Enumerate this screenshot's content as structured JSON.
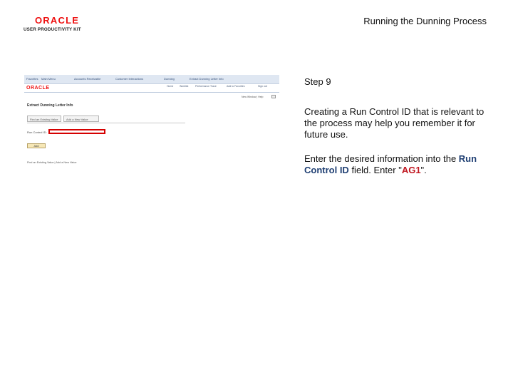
{
  "logo": {
    "brand": "ORACLE",
    "subtitle": "USER PRODUCTIVITY KIT"
  },
  "header": {
    "title": "Running the Dunning Process"
  },
  "screenshot": {
    "nav_items": [
      "Favorites",
      "Main Menu",
      "Accounts Receivable",
      "Customer Interactions",
      "Dunning",
      "Extract Dunning Letter Info"
    ],
    "top_links": [
      "Home",
      "Worklist",
      "Performance Trace",
      "Add to Favorites",
      "Sign out"
    ],
    "new_window": "New Window | Help",
    "page_heading": "Extract Dunning Letter Info",
    "tabs": [
      "Find an Existing Value",
      "Add a New Value"
    ],
    "field_label": "Run Control ID:",
    "field_value": "",
    "add_button": "Add",
    "find_links": "Find an Existing Value | Add a New Value",
    "highlight_color": "#d50000"
  },
  "instructions": {
    "step": "Step 9",
    "paragraph1": "Creating a Run Control ID that is relevant to the process may help you remember it for future use.",
    "p2_prefix": "Enter the desired information into the ",
    "p2_field": "Run Control ID",
    "p2_middle": " field. Enter \"",
    "p2_value": "AG1",
    "p2_suffix": "\"."
  }
}
